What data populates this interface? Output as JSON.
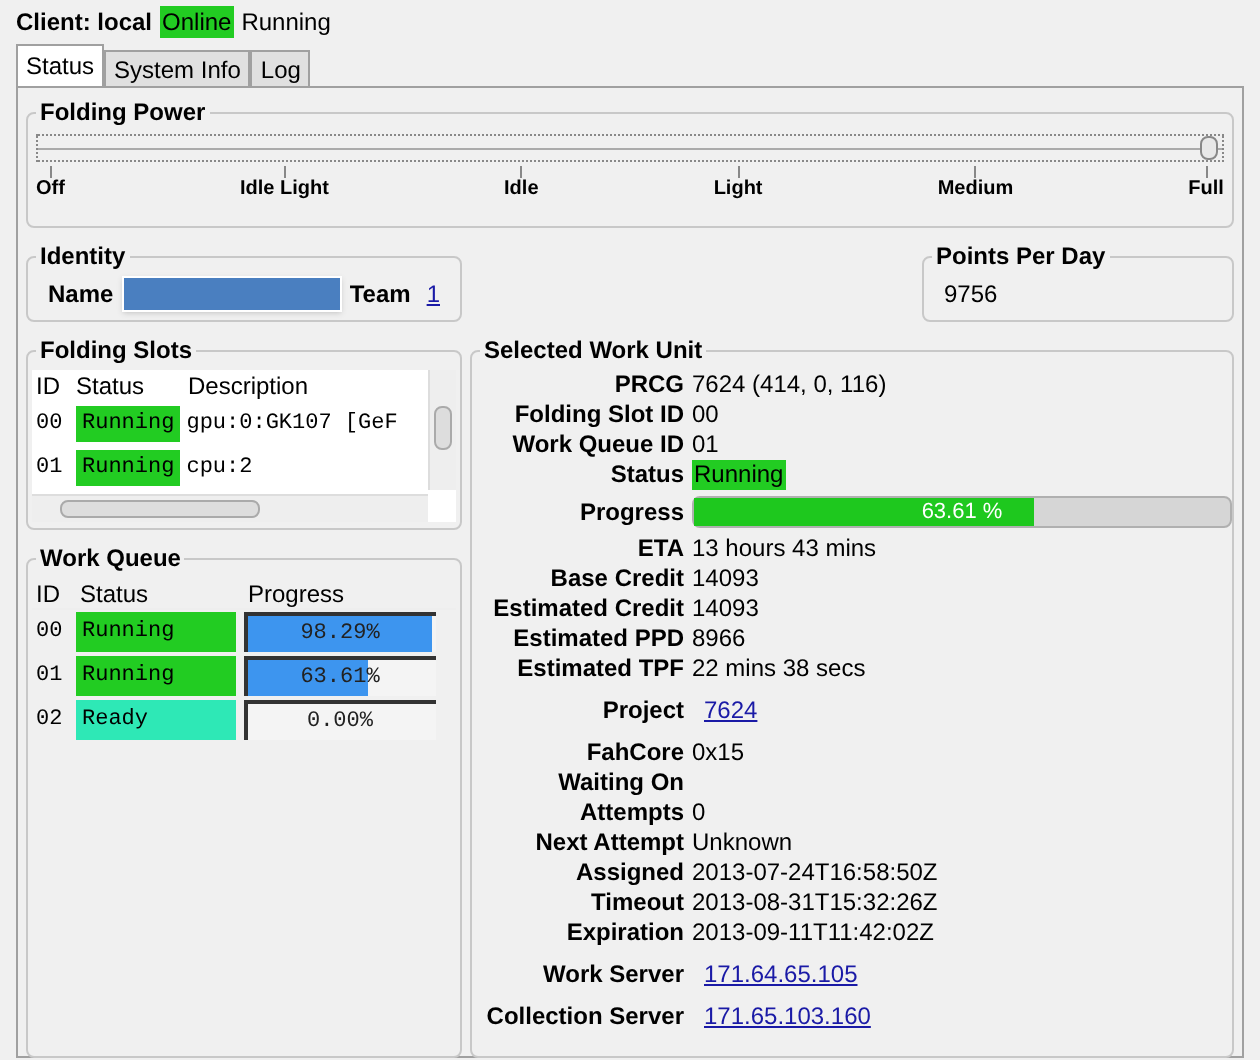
{
  "client": {
    "label": "Client: local",
    "online": "Online",
    "state": "Running"
  },
  "tabs": [
    {
      "label": "Status",
      "selected": true
    },
    {
      "label": "System Info",
      "selected": false
    },
    {
      "label": "Log",
      "selected": false
    }
  ],
  "folding_power": {
    "title": "Folding Power",
    "level": 1,
    "ticks": [
      "Off",
      "Idle Light",
      "Idle",
      "Light",
      "Medium",
      "Full"
    ]
  },
  "identity": {
    "title": "Identity",
    "name_label": "Name",
    "team_label": "Team",
    "team": "1"
  },
  "points_per_day": {
    "title": "Points Per Day",
    "value": "9756"
  },
  "folding_slots": {
    "title": "Folding Slots",
    "columns": [
      "ID",
      "Status",
      "Description"
    ],
    "rows": [
      {
        "id": "00",
        "status": "Running",
        "color": "#22cc22",
        "description": "gpu:0:GK107 [GeF"
      },
      {
        "id": "01",
        "status": "Running",
        "color": "#22cc22",
        "description": "cpu:2"
      }
    ]
  },
  "work_queue": {
    "title": "Work Queue",
    "columns": [
      "ID",
      "Status",
      "Progress"
    ],
    "rows": [
      {
        "id": "00",
        "status": "Running",
        "color": "#22cc22",
        "level": 0.9829,
        "progress": "98.29%"
      },
      {
        "id": "01",
        "status": "Running",
        "color": "#22cc22",
        "level": 0.6361,
        "progress": "63.61%"
      },
      {
        "id": "02",
        "status": "Ready",
        "color": "#2ee8b6",
        "level": 0,
        "progress": "0.00%"
      }
    ]
  },
  "work_unit": {
    "title": "Selected Work Unit",
    "fields": [
      {
        "kind": "text",
        "label": "PRCG",
        "value": "7624 (414, 0, 116)"
      },
      {
        "kind": "text",
        "label": "Folding Slot ID",
        "value": "00"
      },
      {
        "kind": "text",
        "label": "Work Queue ID",
        "value": "01"
      },
      {
        "kind": "status",
        "label": "Status",
        "value": "Running"
      },
      {
        "kind": "progress",
        "label": "Progress",
        "value": "63.61 %",
        "level": 0.6361
      },
      {
        "kind": "text",
        "label": "ETA",
        "value": "13 hours 43 mins"
      },
      {
        "kind": "text",
        "label": "Base Credit",
        "value": "14093"
      },
      {
        "kind": "text",
        "label": "Estimated Credit",
        "value": "14093"
      },
      {
        "kind": "text",
        "label": "Estimated PPD",
        "value": "8966"
      },
      {
        "kind": "text",
        "label": "Estimated TPF",
        "value": "22 mins 38 secs"
      },
      {
        "kind": "link",
        "label": "Project",
        "value": "7624"
      },
      {
        "kind": "text",
        "label": "FahCore",
        "value": "0x15"
      },
      {
        "kind": "text",
        "label": "Waiting On"
      },
      {
        "kind": "text",
        "label": "Attempts",
        "value": "0"
      },
      {
        "kind": "text",
        "label": "Next Attempt",
        "value": "Unknown"
      },
      {
        "kind": "text",
        "label": "Assigned",
        "value": "2013-07-24T16:58:50Z"
      },
      {
        "kind": "text",
        "label": "Timeout",
        "value": "2013-08-31T15:32:26Z"
      },
      {
        "kind": "text",
        "label": "Expiration",
        "value": "2013-09-11T11:42:02Z"
      },
      {
        "kind": "link",
        "label": "Work Server",
        "value": "171.64.65.105"
      },
      {
        "kind": "link",
        "label": "Collection Server",
        "value": "171.65.103.160"
      }
    ]
  }
}
